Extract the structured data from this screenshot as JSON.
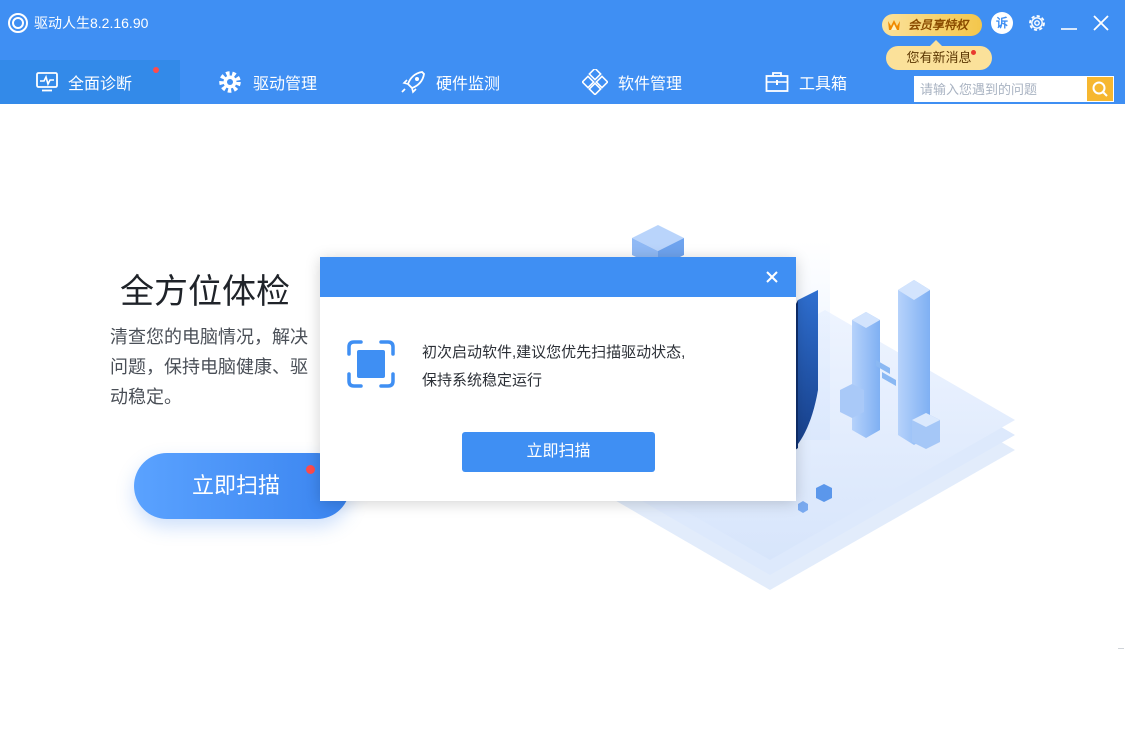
{
  "app": {
    "title": "驱动人生8.2.16.90"
  },
  "titlebar": {
    "vip_label": "会员享特权",
    "message_label": "您有新消息",
    "feedback_label": "诉"
  },
  "nav": {
    "tabs": [
      {
        "label": "全面诊断",
        "icon": "monitor-diagnosis-icon",
        "active": true,
        "dot": true
      },
      {
        "label": "驱动管理",
        "icon": "gear-icon",
        "active": false
      },
      {
        "label": "硬件监测",
        "icon": "rocket-icon",
        "active": false
      },
      {
        "label": "软件管理",
        "icon": "cubes-icon",
        "active": false
      },
      {
        "label": "工具箱",
        "icon": "toolbox-icon",
        "active": false
      }
    ]
  },
  "search": {
    "placeholder": "请输入您遇到的问题",
    "value": ""
  },
  "hero": {
    "title": "全方位体检",
    "description": "清查您的电脑情况，解决问题，保持电脑健康、驱动稳定。",
    "scan_button": "立即扫描"
  },
  "modal": {
    "line1": "初次启动软件,建议您优先扫描驱动状态,",
    "line2": "保持系统稳定运行",
    "button": "立即扫描"
  },
  "colors": {
    "primary": "#3f8ff3",
    "active_tab": "#338ae9",
    "accent_gold": "#f3c64b",
    "alert_dot": "#ff4b4b"
  }
}
